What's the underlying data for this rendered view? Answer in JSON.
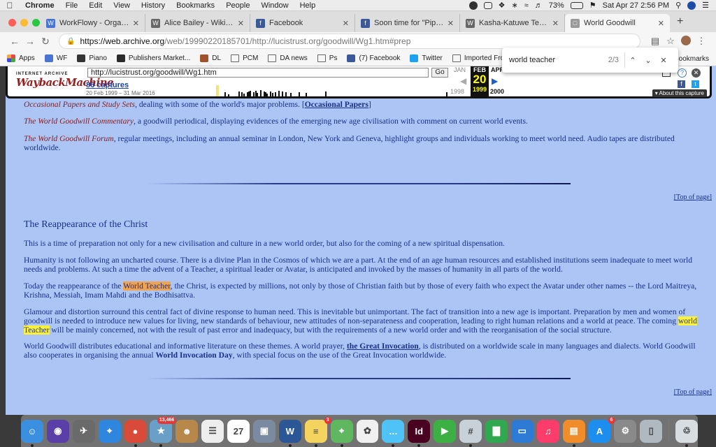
{
  "menubar": {
    "items": [
      "Chrome",
      "File",
      "Edit",
      "View",
      "History",
      "Bookmarks",
      "People",
      "Window",
      "Help"
    ],
    "battery": "73%",
    "datetime": "Sat Apr 27  2:56 PM"
  },
  "tabs": [
    {
      "label": "WorkFlowy - Organize your",
      "fav_color": "#4a74d4",
      "fav": "W"
    },
    {
      "label": "Alice Bailey - Wikipedia",
      "fav_color": "#666",
      "fav": "W"
    },
    {
      "label": "Facebook",
      "fav_color": "#3b5998",
      "fav": "f"
    },
    {
      "label": "Soon time for \"Pippi\" to re",
      "fav_color": "#3b5998",
      "fav": "f"
    },
    {
      "label": "Kasha-Katuwe Tent Rocks",
      "fav_color": "#666",
      "fav": "W"
    },
    {
      "label": "World Goodwill",
      "fav_color": "#999",
      "fav": "□"
    }
  ],
  "omnibox": {
    "host": "https://web.archive.org",
    "path": "/web/19990220185701/http://lucistrust.org/goodwill/Wg1.htm#prep"
  },
  "bookmarks": [
    {
      "label": "Apps",
      "kind": "apps"
    },
    {
      "label": "WF",
      "kind": "icon",
      "color": "#4a74d4"
    },
    {
      "label": "Piano",
      "kind": "icon",
      "color": "#333"
    },
    {
      "label": "Publishers Market...",
      "kind": "icon",
      "color": "#2a2a2a"
    },
    {
      "label": "DL",
      "kind": "icon",
      "color": "#a0522d"
    },
    {
      "label": "PCM",
      "kind": "folder"
    },
    {
      "label": "DA news",
      "kind": "folder"
    },
    {
      "label": "Ps",
      "kind": "folder"
    },
    {
      "label": "(7) Facebook",
      "kind": "icon",
      "color": "#3b5998"
    },
    {
      "label": "Twitter",
      "kind": "icon",
      "color": "#1da1f2"
    },
    {
      "label": "Imported From Sa...",
      "kind": "folder"
    }
  ],
  "bookmarks_right": "Bookmarks",
  "find": {
    "query": "world teacher",
    "count": "2/3"
  },
  "wayback": {
    "logo_top": "INTERNET ARCHIVE",
    "logo_main": "WaybackMachine",
    "url": "http://lucistrust.org/goodwill/Wg1.htm",
    "go": "Go",
    "captures": "86 captures",
    "range": "20 Feb 1999 – 31 Mar 2016",
    "prev_month": "JAN",
    "cur_month": "FEB",
    "next_month": "APR",
    "cur_day": "20",
    "prev_year": "1998",
    "cur_year": "1999",
    "next_year": "2000",
    "about": "About this capture"
  },
  "content": {
    "p1_italic": "Occasional Papers and Study Sets",
    "p1_rest": ", dealing with some of the world's major problems. [",
    "p1_link": "Occasional Papers",
    "p1_end": "]",
    "p2_italic": "The World Goodwill Commentary",
    "p2_rest": ", a goodwill periodical, displaying evidences of the emerging new age civilisation with comment on current world events.",
    "p3_italic": "The World Goodwill Forum",
    "p3_rest": ", regular meetings, including an annual seminar in London, New York and Geneva, highlight groups and individuals working to meet world need. Audio tapes are distributed worldwide.",
    "top_link": "[Top of page]",
    "heading": "The Reappearance of the Christ",
    "para1": "This is a time of preparation not only for a new civilisation and culture in a new world order, but also for the coming of a new spiritual dispensation.",
    "para2": "Humanity is not following an uncharted course. There is a divine Plan in the Cosmos of which we are a part. At the end of an age human resources and established institutions seem inadequate to meet world needs and problems. At such a time the advent of a Teacher, a spiritual leader or Avatar, is anticipated and invoked by the masses of humanity in all parts of the world.",
    "para3_a": "Today the reappearance of the ",
    "para3_hl": "World Teacher",
    "para3_b": ", the Christ, is expected by millions, not only by those of Christian faith but by those of every faith who expect the Avatar under other names -- the Lord Maitreya, Krishna, Messiah, Imam Mahdi and the Bodhisattva.",
    "para4_a": "Glamour and distortion surround this central fact of divine response to human need. This is inevitable but unimportant. The fact of transition into a new age is important. Preparation by men and women of goodwill is needed to introduce new values for living, new standards of behaviour, new attitudes of non-separateness and cooperation, leading to right human relations and a world at peace. The coming ",
    "para4_hl": "world Teacher",
    "para4_b": " will be mainly concerned, not with the result of past error and inadequacy, but with the requirements of a new world order and with the reorganisation of the social structure.",
    "para5_a": "World Goodwill distributes educational and informative literature on these themes. A world prayer, ",
    "para5_link": "the Great Invocation",
    "para5_b": ", is distributed on a worldwide scale in many languages and dialects. World Goodwill also cooperates in organising the annual ",
    "para5_bold": "World Invocation Day",
    "para5_c": ", with special focus on the use of the Great Invocation worldwide."
  },
  "dock": [
    {
      "name": "finder",
      "color": "#3b8fe0",
      "glyph": "☺"
    },
    {
      "name": "siri",
      "color": "#5a3fa8",
      "glyph": "◉"
    },
    {
      "name": "launchpad",
      "color": "#6a6a6a",
      "glyph": "✈"
    },
    {
      "name": "safari",
      "color": "#2e86de",
      "glyph": "⌖"
    },
    {
      "name": "chrome",
      "color": "#d94a38",
      "glyph": "●"
    },
    {
      "name": "photos-app",
      "color": "#6aa0c8",
      "glyph": "★",
      "badge": "13,466"
    },
    {
      "name": "contacts",
      "color": "#b8884a",
      "glyph": "☻"
    },
    {
      "name": "reminders",
      "color": "#eeeeee",
      "glyph": "☰"
    },
    {
      "name": "calendar",
      "color": "#ffffff",
      "glyph": "27"
    },
    {
      "name": "preview",
      "color": "#7a8aa0",
      "glyph": "▣"
    },
    {
      "name": "word",
      "color": "#2b5797",
      "glyph": "W"
    },
    {
      "name": "notes",
      "color": "#f4d35e",
      "glyph": "≡",
      "badge": "3"
    },
    {
      "name": "maps",
      "color": "#5fb760",
      "glyph": "⌖"
    },
    {
      "name": "photos",
      "color": "#f0f0f0",
      "glyph": "✿"
    },
    {
      "name": "messages",
      "color": "#4fc3f7",
      "glyph": "…"
    },
    {
      "name": "indesign",
      "color": "#49021f",
      "glyph": "Id"
    },
    {
      "name": "facetime",
      "color": "#3cb043",
      "glyph": "▶"
    },
    {
      "name": "slack",
      "color": "#c8d0d8",
      "glyph": "#"
    },
    {
      "name": "numbers",
      "color": "#2fa84f",
      "glyph": "▇"
    },
    {
      "name": "keynote",
      "color": "#2e7bd6",
      "glyph": "▭"
    },
    {
      "name": "music",
      "color": "#fc3c6a",
      "glyph": "♫"
    },
    {
      "name": "books",
      "color": "#f08c2a",
      "glyph": "▤"
    },
    {
      "name": "app-store",
      "color": "#1c8ef0",
      "glyph": "A",
      "badge": "6"
    },
    {
      "name": "system-preferences",
      "color": "#8a8a8a",
      "glyph": "⚙"
    },
    {
      "name": "utility",
      "color": "#b0b8c0",
      "glyph": "▯"
    },
    {
      "name": "trash",
      "color": "#d8dde2",
      "glyph": "♲"
    }
  ]
}
